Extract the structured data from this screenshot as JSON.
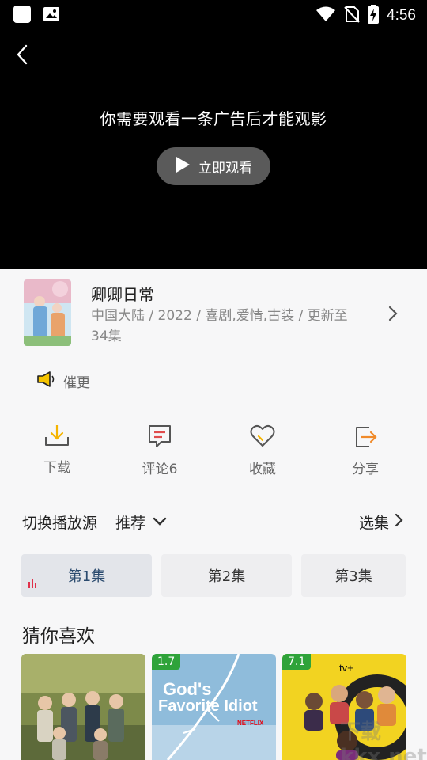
{
  "status_bar": {
    "time": "4:56"
  },
  "player": {
    "ad_message": "你需要观看一条广告后才能观影",
    "watch_label": "立即观看"
  },
  "show": {
    "title": "卿卿日常",
    "meta": "中国大陆 / 2022 / 喜剧,爱情,古装 / 更新至34集",
    "urge_label": "催更"
  },
  "actions": {
    "download": "下载",
    "comment": "评论6",
    "favorite": "收藏",
    "share": "分享"
  },
  "source": {
    "label": "切换播放源",
    "value": "推荐",
    "pick_label": "选集"
  },
  "episodes": [
    "第1集",
    "第2集",
    "第3集"
  ],
  "recommend": {
    "heading": "猜你喜欢",
    "cards": [
      {
        "score": ""
      },
      {
        "score": "1.7",
        "poster_title": "God's Favorite Idiot",
        "brand": "NETFLIX"
      },
      {
        "score": "7.1",
        "brand": "tv+"
      }
    ]
  },
  "watermark": "下载 kkx.net"
}
